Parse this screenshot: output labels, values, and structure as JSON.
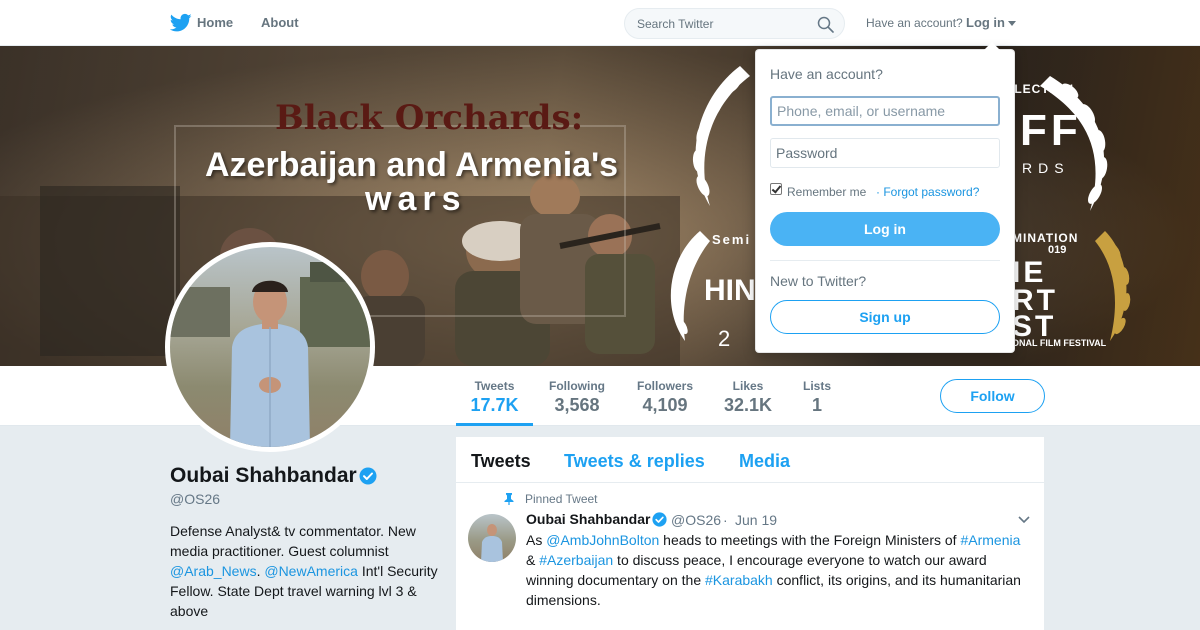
{
  "nav": {
    "home_label": "Home",
    "about_label": "About",
    "search_placeholder": "Search Twitter",
    "have_account": "Have an account?",
    "login_label": "Log in"
  },
  "banner": {
    "title_line1": "Black Orchards:",
    "title_line2": "Azerbaijan and Armenia's",
    "title_line3": "wars",
    "festival_texts": [
      "COLLECTION",
      "FF",
      "RDS",
      "MINATION",
      "019",
      "IE",
      "RT",
      "ST",
      "ONAL FILM FESTIVAL",
      "Semi",
      "HIN",
      "2"
    ]
  },
  "profile": {
    "name": "Oubai Shahbandar",
    "handle": "@OS26",
    "bio_part1": "Defense Analyst& tv commentator. New media practitioner. Guest columnist ",
    "bio_link1": "@Arab_News",
    "bio_sep": ". ",
    "bio_link2": "@NewAmerica",
    "bio_part2": " Int'l Security Fellow. State Dept travel warning lvl 3 & above"
  },
  "stats": [
    {
      "label": "Tweets",
      "value": "17.7K"
    },
    {
      "label": "Following",
      "value": "3,568"
    },
    {
      "label": "Followers",
      "value": "4,109"
    },
    {
      "label": "Likes",
      "value": "32.1K"
    },
    {
      "label": "Lists",
      "value": "1"
    }
  ],
  "follow_label": "Follow",
  "timeline": {
    "tabs": [
      "Tweets",
      "Tweets & replies",
      "Media"
    ],
    "pinned_label": "Pinned Tweet",
    "tweet": {
      "name": "Oubai Shahbandar",
      "handle": "@OS26",
      "dot": "·",
      "date": "Jun 19",
      "t1": "As ",
      "m1": "@AmbJohnBolton",
      "t2": " heads to meetings with the Foreign Ministers of ",
      "h1": "#Armenia",
      "t3": " & ",
      "h2": "#Azerbaijan",
      "t4": " to discuss peace, I encourage everyone to watch our award winning documentary on the ",
      "h3": "#Karabakh",
      "t5": " conflict, its origins, and its humanitarian dimensions."
    }
  },
  "login_dropdown": {
    "heading": "Have an account?",
    "username_placeholder": "Phone, email, or username",
    "password_placeholder": "Password",
    "remember": "Remember me",
    "forgot": "· Forgot password?",
    "login_button": "Log in",
    "new_to_twitter": "New to Twitter?",
    "signup_button": "Sign up"
  },
  "colors": {
    "accent": "#1da1f2",
    "link": "#1b95e0",
    "login_button": "#4ab3f4"
  }
}
